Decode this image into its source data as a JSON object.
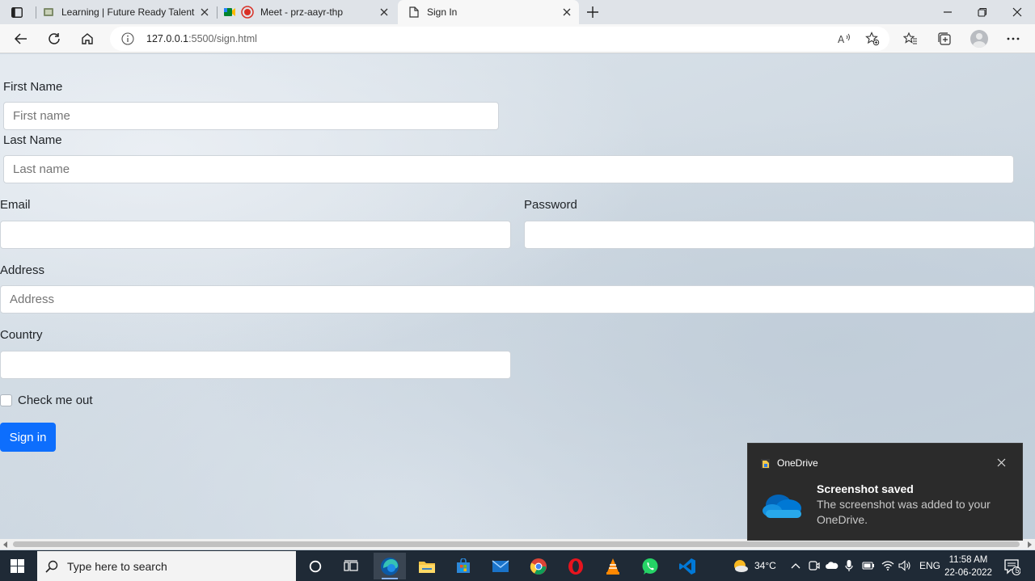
{
  "browser": {
    "tabs": [
      {
        "title": "Learning | Future Ready Talent",
        "active": false
      },
      {
        "title": "Meet - prz-aayr-thp",
        "active": false
      },
      {
        "title": "Sign In",
        "active": true
      }
    ],
    "url_host": "127.0.0.1",
    "url_rest": ":5500/sign.html"
  },
  "form": {
    "first_name_label": "First Name",
    "first_name_placeholder": "First name",
    "last_name_label": "Last Name",
    "last_name_placeholder": "Last name",
    "email_label": "Email",
    "email_value": "",
    "password_label": "Password",
    "password_value": "",
    "address_label": "Address",
    "address_placeholder": "Address",
    "country_label": "Country",
    "country_value": "",
    "check_label": "Check me out",
    "submit_label": "Sign in",
    "primary_color": "#0d6efd"
  },
  "toast": {
    "app": "OneDrive",
    "title": "Screenshot saved",
    "body": "The screenshot was added to your OneDrive."
  },
  "taskbar": {
    "search_placeholder": "Type here to search",
    "apps": [
      "task-view",
      "widgets",
      "edge",
      "file-explorer",
      "microsoft-store",
      "mail",
      "chrome",
      "opera",
      "vlc",
      "whatsapp",
      "vscode"
    ],
    "weather_temp": "34°C",
    "language": "ENG",
    "time": "11:58 AM",
    "date": "22-06-2022",
    "notification_count": "5"
  }
}
